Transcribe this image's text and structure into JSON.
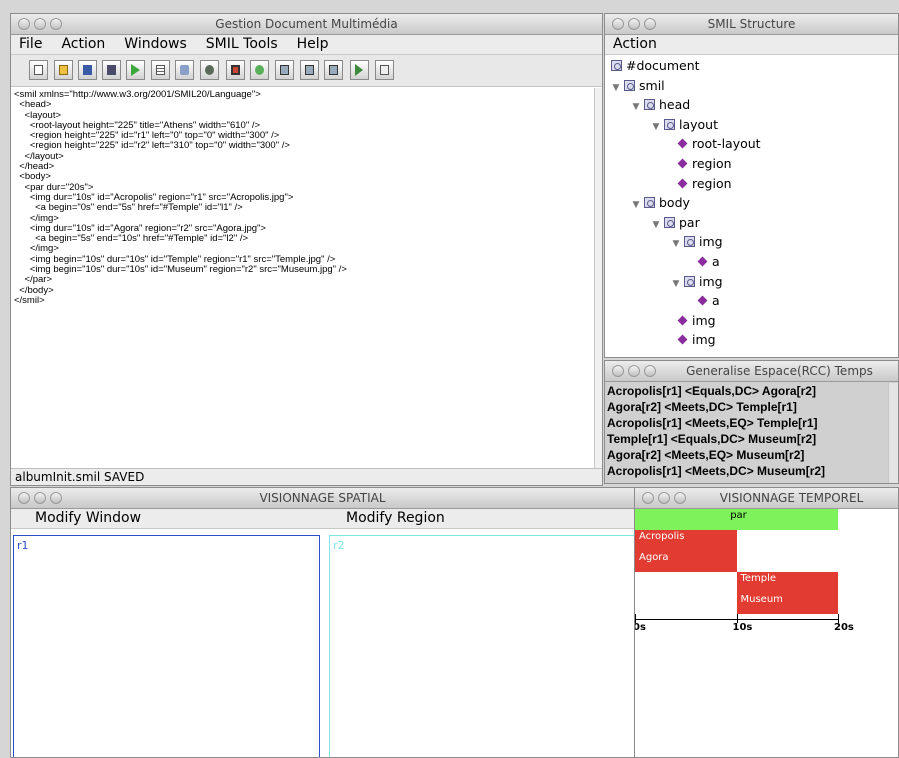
{
  "main": {
    "title": "Gestion Document Multimédia",
    "menu": [
      "File",
      "Action",
      "Windows",
      "SMIL Tools",
      "Help"
    ],
    "toolbar": [
      "new-icon",
      "open-icon",
      "save-icon",
      "save-all-icon",
      "play-icon",
      "list-icon",
      "spatial-icon",
      "temporal-icon",
      "layout-icon",
      "run-icon",
      "region-icon",
      "region-icon",
      "region-icon",
      "step-icon",
      "export-icon"
    ],
    "code_lines": [
      "<smil xmlns=\"http://www.w3.org/2001/SMIL20/Language\">",
      "  <head>",
      "    <layout>",
      "      <root-layout height=\"225\" title=\"Athens\" width=\"610\" />",
      "      <region height=\"225\" id=\"r1\" left=\"0\" top=\"0\" width=\"300\" />",
      "      <region height=\"225\" id=\"r2\" left=\"310\" top=\"0\" width=\"300\" />",
      "    </layout>",
      "  </head>",
      "  <body>",
      "    <par dur=\"20s\">",
      "      <img dur=\"10s\" id=\"Acropolis\" region=\"r1\" src=\"Acropolis.jpg\">",
      "        <a begin=\"0s\" end=\"5s\" href=\"#Temple\" id=\"l1\" />",
      "      </img>",
      "      <img dur=\"10s\" id=\"Agora\" region=\"r2\" src=\"Agora.jpg\">",
      "        <a begin=\"5s\" end=\"10s\" href=\"#Temple\" id=\"l2\" />",
      "      </img>",
      "      <img begin=\"10s\" dur=\"10s\" id=\"Temple\" region=\"r1\" src=\"Temple.jpg\" />",
      "      <img begin=\"10s\" dur=\"10s\" id=\"Museum\" region=\"r2\" src=\"Museum.jpg\" />",
      "    </par>",
      "  </body>",
      "</smil>"
    ],
    "status": "albumInit.smil SAVED"
  },
  "structure": {
    "title": "SMIL Structure",
    "menu": "Action",
    "nodes": [
      {
        "label": "#document",
        "depth": 0,
        "kind": "element",
        "expanded": false
      },
      {
        "label": "smil",
        "depth": 0,
        "kind": "element",
        "expanded": true
      },
      {
        "label": "head",
        "depth": 1,
        "kind": "element",
        "expanded": true
      },
      {
        "label": "layout",
        "depth": 2,
        "kind": "element",
        "expanded": true
      },
      {
        "label": "root-layout",
        "depth": 3,
        "kind": "leaf"
      },
      {
        "label": "region",
        "depth": 3,
        "kind": "leaf"
      },
      {
        "label": "region",
        "depth": 3,
        "kind": "leaf"
      },
      {
        "label": "body",
        "depth": 1,
        "kind": "element",
        "expanded": true
      },
      {
        "label": "par",
        "depth": 2,
        "kind": "element",
        "expanded": true
      },
      {
        "label": "img",
        "depth": 3,
        "kind": "element",
        "expanded": true
      },
      {
        "label": "a",
        "depth": 4,
        "kind": "leaf"
      },
      {
        "label": "img",
        "depth": 3,
        "kind": "element",
        "expanded": true
      },
      {
        "label": "a",
        "depth": 4,
        "kind": "leaf"
      },
      {
        "label": "img",
        "depth": 3,
        "kind": "leaf"
      },
      {
        "label": "img",
        "depth": 3,
        "kind": "leaf"
      }
    ]
  },
  "rcc": {
    "title": "Generalise Espace(RCC) Temps",
    "relations": [
      "Acropolis[r1] <Equals,DC> Agora[r2]",
      "Agora[r2] <Meets,DC> Temple[r1]",
      "Acropolis[r1] <Meets,EQ> Temple[r1]",
      "Temple[r1] <Equals,DC> Museum[r2]",
      "Agora[r2] <Meets,EQ> Museum[r2]",
      "Acropolis[r1] <Meets,DC> Museum[r2]"
    ]
  },
  "spatial": {
    "title": "VISIONNAGE SPATIAL",
    "modify_window": "Modify Window",
    "modify_region": "Modify Region",
    "regions": [
      {
        "id": "r1",
        "color": "#2a4fc9"
      },
      {
        "id": "r2",
        "color": "#7fe6e6"
      }
    ]
  },
  "temporal": {
    "title": "VISIONNAGE TEMPOREL",
    "par_color": "#7ef25a",
    "item_color": "#e23b32",
    "par": {
      "label": "par",
      "begin": 0,
      "end": 20
    },
    "items": [
      {
        "label": "Acropolis",
        "begin": 0,
        "end": 10,
        "row": 1
      },
      {
        "label": "Agora",
        "begin": 0,
        "end": 10,
        "row": 2
      },
      {
        "label": "Temple",
        "begin": 10,
        "end": 20,
        "row": 3
      },
      {
        "label": "Museum",
        "begin": 10,
        "end": 20,
        "row": 4
      }
    ],
    "ticks": [
      "0s",
      "10s",
      "20s"
    ]
  }
}
